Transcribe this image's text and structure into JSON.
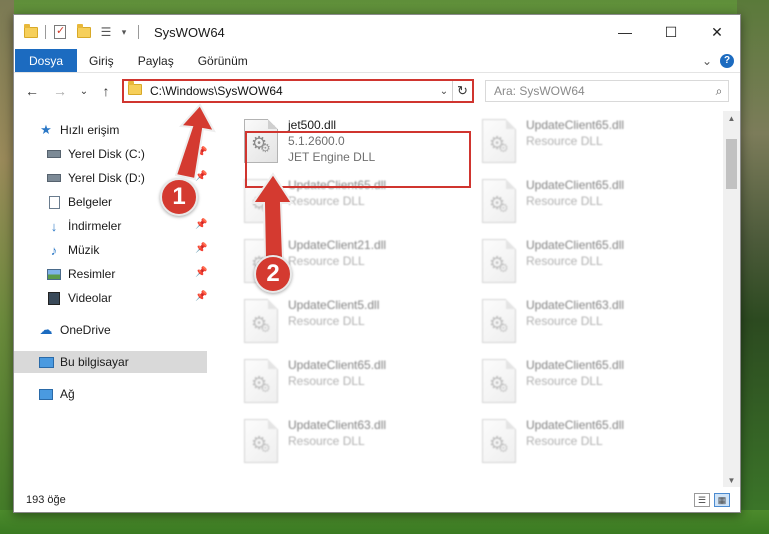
{
  "window": {
    "title": "SysWOW64",
    "minimize": "—",
    "maximize": "☐",
    "close": "✕"
  },
  "ribbon": {
    "tabs": [
      "Dosya",
      "Giriş",
      "Paylaş",
      "Görünüm"
    ],
    "expand": "⌄",
    "help": "?"
  },
  "nav": {
    "back": "←",
    "forward": "→",
    "recent": "⌄",
    "up": "↑"
  },
  "address": {
    "path": "C:\\Windows\\SysWOW64",
    "dropdown": "⌄",
    "refresh": "↻"
  },
  "search": {
    "placeholder": "Ara: SysWOW64",
    "icon": "⌕"
  },
  "sidebar": {
    "items": [
      {
        "label": "Hızlı erişim",
        "icon": "star-icon"
      },
      {
        "label": "Yerel Disk (C:)",
        "icon": "drive-icon"
      },
      {
        "label": "Yerel Disk (D:)",
        "icon": "drive-icon"
      },
      {
        "label": "Belgeler",
        "icon": "documents-icon"
      },
      {
        "label": "İndirmeler",
        "icon": "download-icon"
      },
      {
        "label": "Müzik",
        "icon": "music-icon"
      },
      {
        "label": "Resimler",
        "icon": "pictures-icon"
      },
      {
        "label": "Videolar",
        "icon": "videos-icon"
      },
      {
        "label": "OneDrive",
        "icon": "cloud-icon"
      },
      {
        "label": "Bu bilgisayar",
        "icon": "computer-icon"
      },
      {
        "label": "Ağ",
        "icon": "network-icon"
      }
    ]
  },
  "files": {
    "highlighted": {
      "name": "jet500.dll",
      "version": "5.1.2600.0",
      "description": "JET Engine DLL"
    },
    "tiles": [
      {
        "name": "UpdateClient65.dll",
        "type": "Resource DLL"
      },
      {
        "name": "UpdateClient65.dll",
        "type": "Resource DLL"
      },
      {
        "name": "UpdateClient65.dll",
        "type": "Resource DLL"
      },
      {
        "name": "UpdateClient21.dll",
        "type": "Resource DLL"
      },
      {
        "name": "UpdateClient65.dll",
        "type": "Resource DLL"
      },
      {
        "name": "UpdateClient5.dll",
        "type": "Resource DLL"
      },
      {
        "name": "UpdateClient63.dll",
        "type": "Resource DLL"
      },
      {
        "name": "UpdateClient65.dll",
        "type": "Resource DLL"
      },
      {
        "name": "UpdateClient65.dll",
        "type": "Resource DLL"
      },
      {
        "name": "UpdateClient63.dll",
        "type": "Resource DLL"
      },
      {
        "name": "UpdateClient65.dll",
        "type": "Resource DLL"
      }
    ]
  },
  "status": {
    "count": "193 öğe"
  },
  "annotations": [
    "1",
    "2"
  ],
  "colors": {
    "accent": "#1c6bc0",
    "highlight_red": "#d0352f",
    "annotation_red": "#d43a30"
  }
}
